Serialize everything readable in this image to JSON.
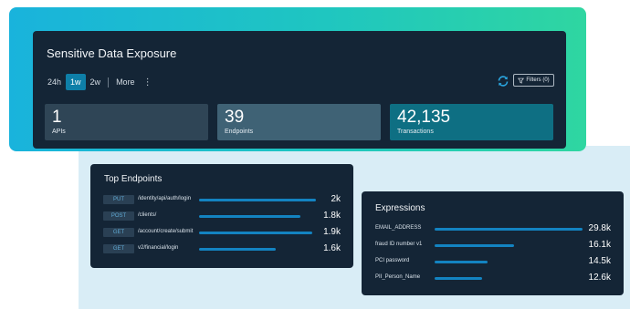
{
  "exposure": {
    "title": "Sensitive Data Exposure",
    "ranges": [
      {
        "label": "24h",
        "active": false
      },
      {
        "label": "1w",
        "active": true
      },
      {
        "label": "2w",
        "active": false
      }
    ],
    "more_label": "More",
    "filters_label": "Filters (0)",
    "stats": [
      {
        "value": "1",
        "label": "APIs"
      },
      {
        "value": "39",
        "label": "Endpoints"
      },
      {
        "value": "42,135",
        "label": "Transactions"
      }
    ]
  },
  "top_endpoints": {
    "title": "Top Endpoints",
    "rows": [
      {
        "method": "PUT",
        "path": "/identity/api/auth/login",
        "value_label": "2k",
        "fraction": 1.0
      },
      {
        "method": "POST",
        "path": "/clients/",
        "value_label": "1.8k",
        "fraction": 0.87
      },
      {
        "method": "GET",
        "path": "/account/create/submit",
        "value_label": "1.9k",
        "fraction": 0.97
      },
      {
        "method": "GET",
        "path": "v2/financial/login",
        "value_label": "1.6k",
        "fraction": 0.66
      }
    ]
  },
  "expressions": {
    "title": "Expressions",
    "rows": [
      {
        "label": "EMAIL_ADDRESS",
        "value_label": "29.8k",
        "fraction": 1.0
      },
      {
        "label": "fraud ID number v1",
        "value_label": "16.1k",
        "fraction": 0.54
      },
      {
        "label": "PCI password",
        "value_label": "14.5k",
        "fraction": 0.36
      },
      {
        "label": "PII_Person_Name",
        "value_label": "12.6k",
        "fraction": 0.32
      }
    ]
  },
  "colors": {
    "accent": "#0e7fa8",
    "bar": "#1383c1",
    "card_bg": "#142536"
  },
  "icons": {
    "refresh": "refresh-icon",
    "filter": "filter-icon",
    "more": "more-vertical-icon"
  }
}
